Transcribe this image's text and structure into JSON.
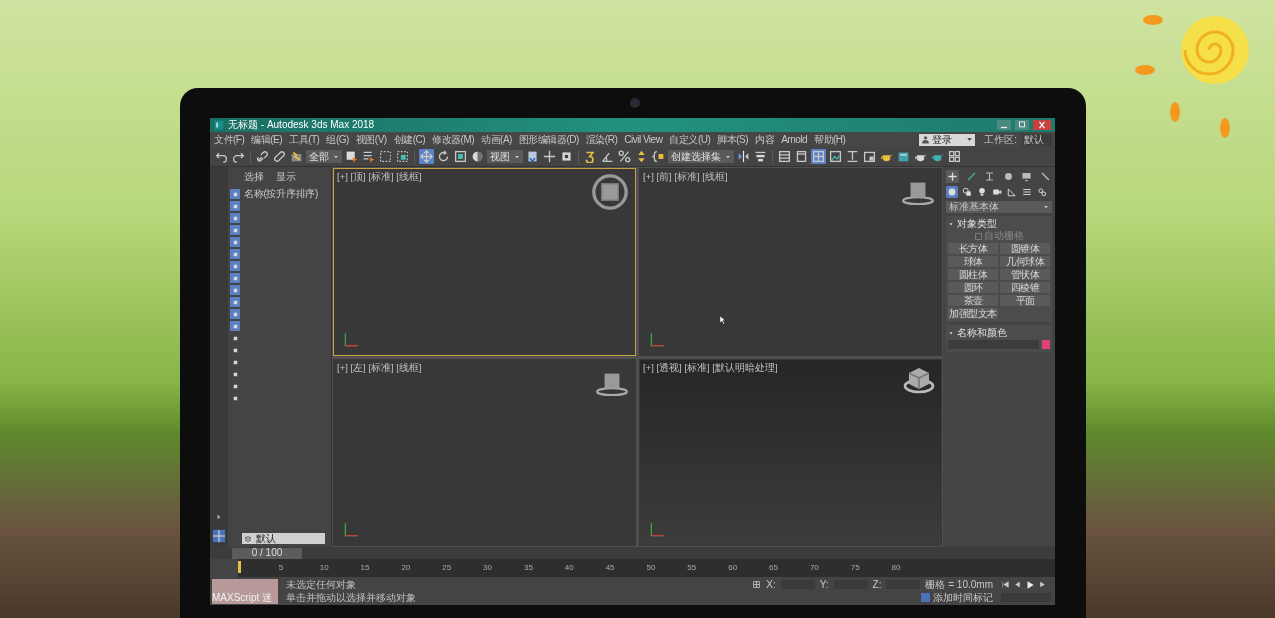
{
  "window": {
    "title": "无标题 - Autodesk 3ds Max 2018"
  },
  "menu": [
    "文件(F)",
    "编辑(E)",
    "工具(T)",
    "组(G)",
    "视图(V)",
    "创建(C)",
    "修改器(M)",
    "动画(A)",
    "图形编辑器(D)",
    "渲染(R)",
    "Civil View",
    "自定义(U)",
    "脚本(S)",
    "内容",
    "Arnold",
    "帮助(H)"
  ],
  "account": {
    "login": "登录",
    "workspace_label": "工作区:",
    "workspace": "默认"
  },
  "toolbar": [
    {
      "kind": "button",
      "selected": false
    },
    {
      "kind": "button",
      "selected": false
    },
    {
      "kind": "separator"
    },
    {
      "kind": "button",
      "selected": false
    },
    {
      "kind": "button",
      "selected": false
    },
    {
      "kind": "button",
      "selected": false
    },
    {
      "kind": "dropdown",
      "value": "全部"
    },
    {
      "kind": "button",
      "selected": false
    },
    {
      "kind": "button",
      "selected": false
    },
    {
      "kind": "button",
      "selected": false
    },
    {
      "kind": "button",
      "selected": false
    },
    {
      "kind": "separator"
    },
    {
      "kind": "button",
      "selected": true
    },
    {
      "kind": "button",
      "selected": false
    },
    {
      "kind": "button",
      "selected": false
    },
    {
      "kind": "button",
      "selected": false
    },
    {
      "kind": "dropdown",
      "value": "视图"
    },
    {
      "kind": "button",
      "selected": false
    },
    {
      "kind": "button",
      "selected": false
    },
    {
      "kind": "button",
      "selected": false
    },
    {
      "kind": "separator"
    },
    {
      "kind": "button",
      "selected": false
    },
    {
      "kind": "button",
      "selected": false
    },
    {
      "kind": "button",
      "selected": false
    },
    {
      "kind": "button",
      "selected": false
    },
    {
      "kind": "button",
      "selected": false
    },
    {
      "kind": "dropdown",
      "value": "创建选择集"
    },
    {
      "kind": "button",
      "selected": false
    },
    {
      "kind": "button",
      "selected": false
    },
    {
      "kind": "separator"
    },
    {
      "kind": "button",
      "selected": false
    },
    {
      "kind": "button",
      "selected": false
    },
    {
      "kind": "button",
      "selected": true
    },
    {
      "kind": "button",
      "selected": false
    },
    {
      "kind": "button",
      "selected": false
    },
    {
      "kind": "button",
      "selected": false
    },
    {
      "kind": "button",
      "selected": false
    },
    {
      "kind": "button",
      "selected": false
    },
    {
      "kind": "button",
      "selected": false
    },
    {
      "kind": "button",
      "selected": false
    },
    {
      "kind": "button",
      "selected": false
    }
  ],
  "scene_explorer": {
    "tabs": [
      "选择",
      "显示"
    ],
    "column": "名称(按升序排序)",
    "filters": [
      {
        "on": true
      },
      {
        "on": true
      },
      {
        "on": true
      },
      {
        "on": true
      },
      {
        "on": true
      },
      {
        "on": true
      },
      {
        "on": true
      },
      {
        "on": true
      },
      {
        "on": true
      },
      {
        "on": true
      },
      {
        "on": true
      },
      {
        "on": true
      },
      {
        "on": false
      },
      {
        "on": false
      },
      {
        "on": false
      },
      {
        "on": false
      },
      {
        "on": false
      },
      {
        "on": false
      }
    ],
    "layer": "默认"
  },
  "viewports": [
    {
      "label": "[+] [顶] [标准] [线框]",
      "kind": "ortho",
      "active": true
    },
    {
      "label": "[+] [前] [标准] [线框]",
      "kind": "ortho",
      "active": false
    },
    {
      "label": "[+] [左] [标准] [线框]",
      "kind": "ortho",
      "active": false
    },
    {
      "label": "[+] [透视] [标准] [默认明暗处理]",
      "kind": "perspective",
      "active": false
    }
  ],
  "command_panel": {
    "tabs": [
      {
        "selected": true
      },
      {
        "selected": false
      },
      {
        "selected": false
      },
      {
        "selected": false
      },
      {
        "selected": false
      },
      {
        "selected": false
      }
    ],
    "categories": [
      {
        "selected": true
      },
      {
        "selected": false
      },
      {
        "selected": false
      },
      {
        "selected": false
      },
      {
        "selected": false
      },
      {
        "selected": false
      },
      {
        "selected": false
      }
    ],
    "dropdown": "标准基本体",
    "object_type": {
      "title": "对象类型",
      "autogrid": "自动栅格",
      "autogrid_checked": false,
      "buttons": [
        "长方体",
        "圆锥体",
        "球体",
        "几何球体",
        "圆柱体",
        "管状体",
        "圆环",
        "四棱锥",
        "茶壶",
        "平面",
        "加强型文本"
      ]
    },
    "name_color": {
      "title": "名称和颜色",
      "color": "#e0407a"
    }
  },
  "timeline": {
    "slider": "0 / 100",
    "ticks": [
      "5",
      "10",
      "15",
      "20",
      "25",
      "30",
      "35",
      "40",
      "45",
      "50",
      "55",
      "60",
      "65",
      "70",
      "75",
      "80"
    ]
  },
  "status": {
    "maxscript": "MAXScript 迷",
    "lines": [
      "未选定任何对象",
      "单击并拖动以选择并移动对象"
    ],
    "x": "X:",
    "y": "Y:",
    "z": "Z:",
    "grid": "栅格 = 10.0mm",
    "time_tag": "添加时间标记",
    "time_tag_checked": true
  }
}
